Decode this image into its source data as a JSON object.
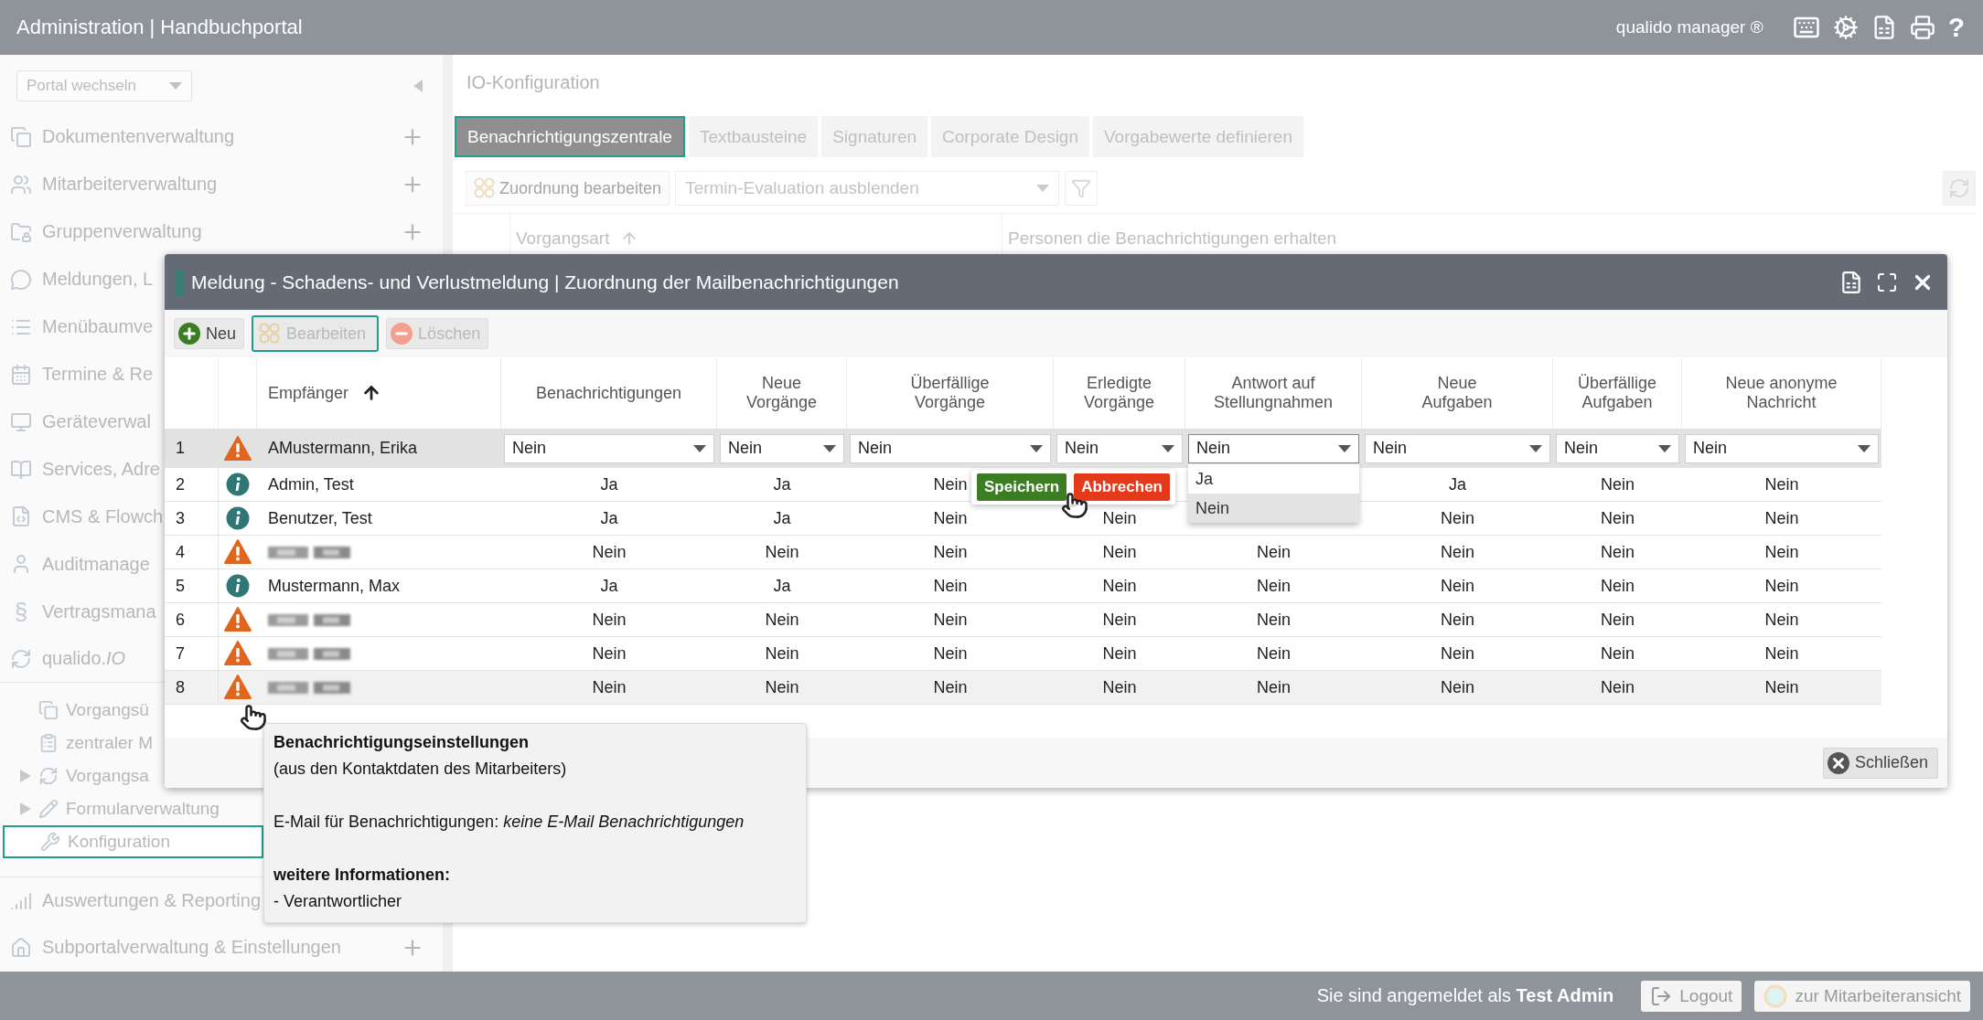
{
  "header": {
    "title": "Administration | Handbuchportal",
    "product": "qualido manager ®",
    "help_glyph": "?"
  },
  "sidebar": {
    "portal_select": "Portal wechseln",
    "items": [
      {
        "label": "Dokumentenverwaltung",
        "expandable": true
      },
      {
        "label": "Mitarbeiterverwaltung",
        "expandable": true
      },
      {
        "label": "Gruppenverwaltung",
        "expandable": true
      },
      {
        "label": "Meldungen, L",
        "expandable": false
      },
      {
        "label": "Menübaumve",
        "expandable": false
      },
      {
        "label": "Termine & Re",
        "expandable": false
      },
      {
        "label": "Geräteverwal",
        "expandable": false
      },
      {
        "label": "Services, Adre",
        "expandable": false
      },
      {
        "label": "CMS & Flowch",
        "expandable": false
      },
      {
        "label": "Auditmanage",
        "expandable": false
      },
      {
        "label": "Vertragsmana",
        "expandable": false,
        "glyph": "§"
      },
      {
        "label": "qualido.*IO*",
        "expandable": false,
        "children": [
          {
            "label": "Vorgangsü",
            "kind": "leaf",
            "selected": false
          },
          {
            "label": "zentraler M",
            "kind": "leaf",
            "selected": false
          },
          {
            "label": "Vorgangsa",
            "kind": "folder",
            "selected": false
          },
          {
            "label": "Formularverwaltung",
            "kind": "folder",
            "selected": false
          },
          {
            "label": "Konfiguration",
            "kind": "leaf",
            "selected": true
          }
        ]
      },
      {
        "label": "Auswertungen & Reporting",
        "expandable": false
      },
      {
        "label": "Subportalverwaltung & Einstellungen",
        "expandable": true
      }
    ]
  },
  "main": {
    "title": "IO-Konfiguration",
    "tabs": [
      {
        "label": "Benachrichtigungszentrale",
        "selected": true
      },
      {
        "label": "Textbausteine",
        "selected": false
      },
      {
        "label": "Signaturen",
        "selected": false
      },
      {
        "label": "Corporate Design",
        "selected": false
      },
      {
        "label": "Vorgabewerte definieren",
        "selected": false
      }
    ],
    "toolbar": {
      "edit_button": "Zuordnung bearbeiten",
      "filter_select": "Termin-Evaluation ausblenden"
    },
    "columns": [
      {
        "label": "Vorgangsart",
        "sorted": true
      },
      {
        "label": "Personen die Benachrichtigungen erhalten",
        "sorted": false
      }
    ]
  },
  "dialog": {
    "title": "Meldung - Schadens- und Verlustmeldung | Zuordnung der Mailbenachrichtigungen",
    "toolbar": [
      {
        "label": "Neu",
        "kind": "add",
        "disabled": false,
        "focused": false
      },
      {
        "label": "Bearbeiten",
        "kind": "edit",
        "disabled": true,
        "focused": true
      },
      {
        "label": "Löschen",
        "kind": "delete",
        "disabled": true,
        "focused": false
      }
    ],
    "recipient_column": {
      "label": "Empfänger",
      "sorted": true
    },
    "columns": [
      {
        "label": "Benachrichtigungen",
        "sorted": false
      },
      {
        "label": "Neue\nVorgänge",
        "sorted": false
      },
      {
        "label": "Überfällige\nVorgänge",
        "sorted": false
      },
      {
        "label": "Erledigte\nVorgänge",
        "sorted": false
      },
      {
        "label": "Antwort auf\nStellungnahmen",
        "sorted": false
      },
      {
        "label": "Neue\nAufgaben",
        "sorted": false
      },
      {
        "label": "Überfällige\nAufgaben",
        "sorted": false
      },
      {
        "label": "Neue anonyme\nNachricht",
        "sorted": false
      }
    ],
    "rows": [
      {
        "number": "1",
        "kind": "warning",
        "name": "AMustermann, Erika",
        "redacted": false,
        "selected": true,
        "hovered": false,
        "editing": true,
        "cells": [
          {
            "value": "Nein",
            "open": false
          },
          {
            "value": "Nein",
            "open": false
          },
          {
            "value": "Nein",
            "open": false
          },
          {
            "value": "Nein",
            "open": false
          },
          {
            "value": "Nein",
            "open": true,
            "options": [
              {
                "label": "Ja",
                "selected": false
              },
              {
                "label": "Nein",
                "selected": true
              }
            ]
          },
          {
            "value": "Nein",
            "open": false
          },
          {
            "value": "Nein",
            "open": false
          },
          {
            "value": "Nein",
            "open": false
          }
        ]
      },
      {
        "number": "2",
        "kind": "info",
        "name": "Admin, Test",
        "redacted": false,
        "selected": false,
        "hovered": false,
        "editing": false,
        "cells": [
          "Ja",
          "Ja",
          "Nein",
          null,
          null,
          "Ja",
          "Nein",
          "Nein"
        ]
      },
      {
        "number": "3",
        "kind": "info",
        "name": "Benutzer, Test",
        "redacted": false,
        "selected": false,
        "hovered": false,
        "editing": false,
        "cells": [
          "Ja",
          "Ja",
          "Nein",
          "Nein",
          null,
          "Nein",
          "Nein",
          "Nein"
        ]
      },
      {
        "number": "4",
        "kind": "warning",
        "redacted": true,
        "selected": false,
        "hovered": false,
        "editing": false,
        "cells": [
          "Nein",
          "Nein",
          "Nein",
          "Nein",
          "Nein",
          "Nein",
          "Nein",
          "Nein"
        ]
      },
      {
        "number": "5",
        "kind": "info",
        "name": "Mustermann, Max",
        "redacted": false,
        "selected": false,
        "hovered": false,
        "editing": false,
        "cells": [
          "Ja",
          "Ja",
          "Nein",
          "Nein",
          "Nein",
          "Nein",
          "Nein",
          "Nein"
        ]
      },
      {
        "number": "6",
        "kind": "warning",
        "redacted": true,
        "selected": false,
        "hovered": false,
        "editing": false,
        "cells": [
          "Nein",
          "Nein",
          "Nein",
          "Nein",
          "Nein",
          "Nein",
          "Nein",
          "Nein"
        ]
      },
      {
        "number": "7",
        "kind": "warning",
        "redacted": true,
        "selected": false,
        "hovered": false,
        "editing": false,
        "cells": [
          "Nein",
          "Nein",
          "Nein",
          "Nein",
          "Nein",
          "Nein",
          "Nein",
          "Nein"
        ]
      },
      {
        "number": "8",
        "kind": "warning",
        "redacted": true,
        "selected": false,
        "hovered": true,
        "editing": false,
        "cells": [
          "Nein",
          "Nein",
          "Nein",
          "Nein",
          "Nein",
          "Nein",
          "Nein",
          "Nein"
        ]
      }
    ],
    "edit_actions": [
      {
        "label": "Speichern",
        "kind": "save"
      },
      {
        "label": "Abbrechen",
        "kind": "cancel"
      }
    ],
    "close_button": "Schließen"
  },
  "tooltip": {
    "title": "Benachrichtigungseinstellungen",
    "subtitle": "(aus den Kontaktdaten des Mitarbeiters)",
    "email_line": "E-Mail für Benachrichtigungen: *keine E-Mail Benachrichtigungen*",
    "info_heading": "weitere Informationen:",
    "info_items": [
      "- Verantwortlicher"
    ]
  },
  "footer": {
    "login_text": "Sie sind angemeldet als **Test Admin**",
    "logout": "Logout",
    "employee_view": "zur Mitarbeiteransicht"
  }
}
